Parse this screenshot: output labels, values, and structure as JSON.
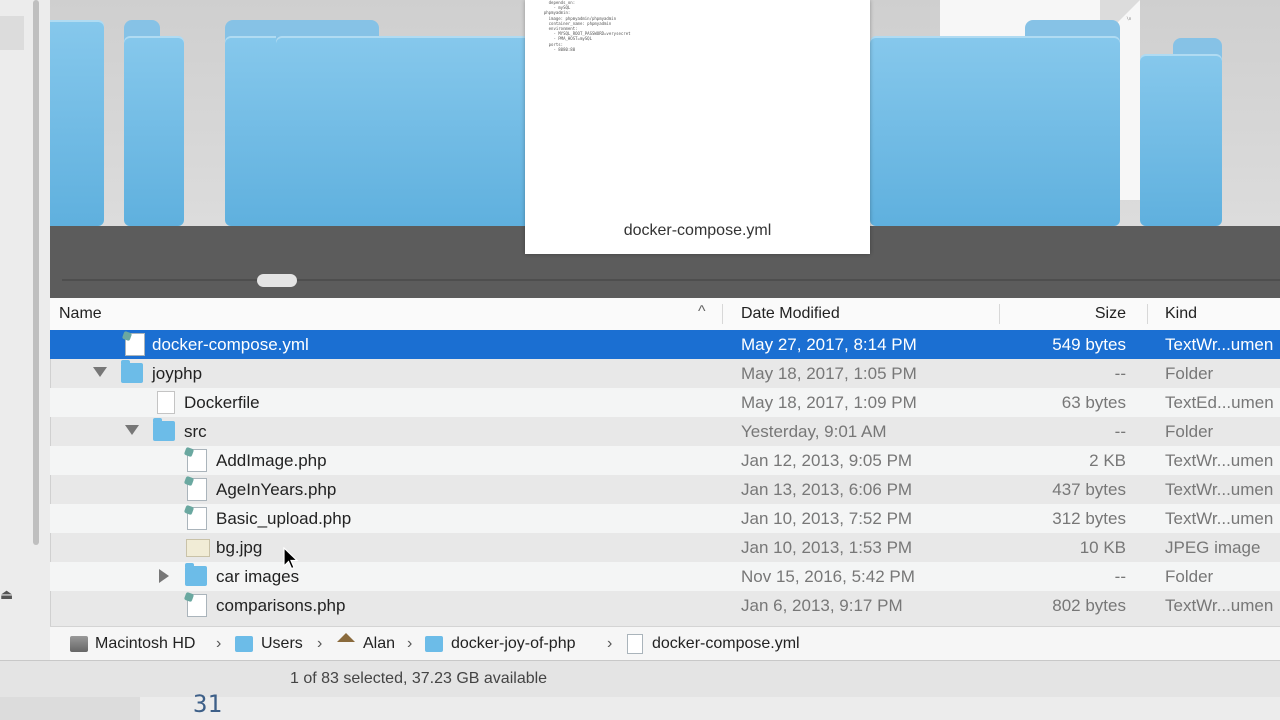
{
  "coverflow": {
    "preview_filename": "docker-compose.yml",
    "preview_code": "    depends_on:\n      - mySQL\n  phpmyadmin:\n    image: phpmyadmin/phpmyadmin\n    container_name: phpmyadmin\n    environment:\n      - MYSQL_ROOT_PASSWORD=verysecret\n      - PMA_HOST=mySQL\n    ports:\n      - 8080:80"
  },
  "columns": {
    "name": "Name",
    "date": "Date Modified",
    "size": "Size",
    "kind": "Kind"
  },
  "rows": [
    {
      "name": "docker-compose.yml",
      "date": "May 27, 2017, 8:14 PM",
      "size": "549 bytes",
      "kind": "TextWr...umen"
    },
    {
      "name": "joyphp",
      "date": "May 18, 2017, 1:05 PM",
      "size": "--",
      "kind": "Folder"
    },
    {
      "name": "Dockerfile",
      "date": "May 18, 2017, 1:09 PM",
      "size": "63 bytes",
      "kind": "TextEd...umen"
    },
    {
      "name": "src",
      "date": "Yesterday, 9:01 AM",
      "size": "--",
      "kind": "Folder"
    },
    {
      "name": "AddImage.php",
      "date": "Jan 12, 2013, 9:05 PM",
      "size": "2 KB",
      "kind": "TextWr...umen"
    },
    {
      "name": "AgeInYears.php",
      "date": "Jan 13, 2013, 6:06 PM",
      "size": "437 bytes",
      "kind": "TextWr...umen"
    },
    {
      "name": "Basic_upload.php",
      "date": "Jan 10, 2013, 7:52 PM",
      "size": "312 bytes",
      "kind": "TextWr...umen"
    },
    {
      "name": "bg.jpg",
      "date": "Jan 10, 2013, 1:53 PM",
      "size": "10 KB",
      "kind": "JPEG image"
    },
    {
      "name": "car images",
      "date": "Nov 15, 2016, 5:42 PM",
      "size": "--",
      "kind": "Folder"
    },
    {
      "name": "comparisons.php",
      "date": "Jan 6, 2013, 9:17 PM",
      "size": "802 bytes",
      "kind": "TextWr...umen"
    }
  ],
  "path": [
    "Macintosh HD",
    "Users",
    "Alan",
    "docker-joy-of-php",
    "docker-compose.yml"
  ],
  "path_separator": "›",
  "status": "1 of 83 selected, 37.23 GB available",
  "behind_window_line_number": "31",
  "icons": {
    "sort": "chevron-up-icon",
    "eject": "eject-icon",
    "disclosure_open": "triangle-down-icon",
    "disclosure_closed": "triangle-right-icon"
  },
  "colors": {
    "selection": "#1b6fd2",
    "folder": "#6cbce8"
  }
}
